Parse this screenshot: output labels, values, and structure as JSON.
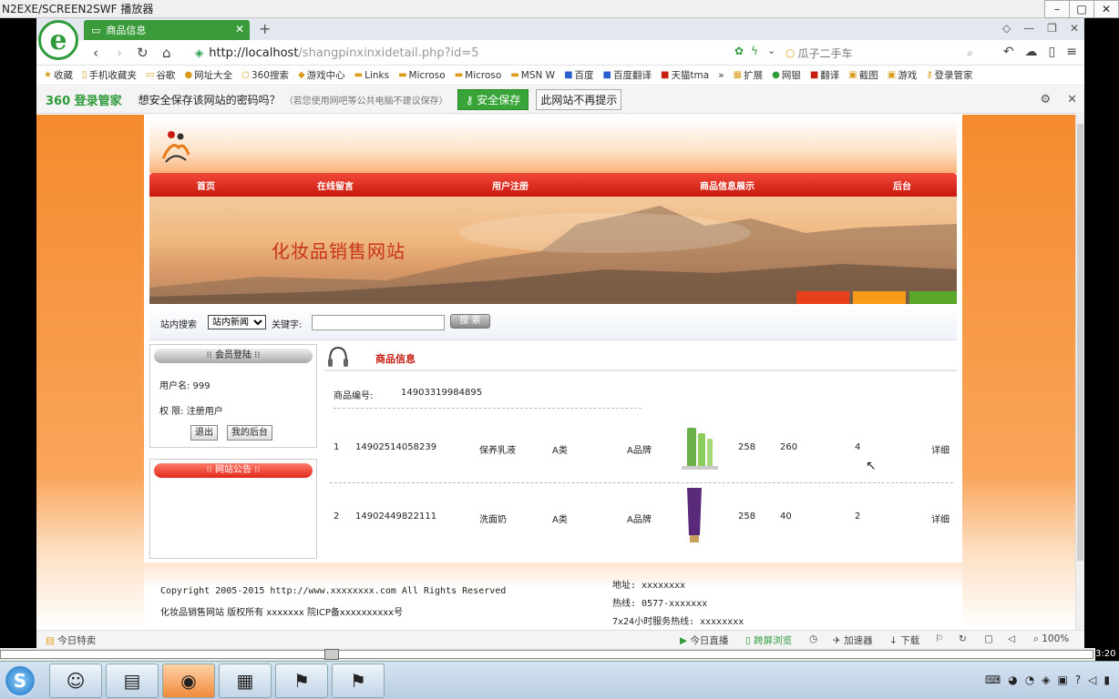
{
  "player": {
    "title": "N2EXE/SCREEN2SWF 播放器",
    "time": "3:20"
  },
  "browser": {
    "tab_title": "商品信息",
    "url_host": "http://localhost",
    "url_path": "/shangpinxinxidetail.php?id=5",
    "search_placeholder": "瓜子二手车",
    "bookmarks": [
      "收藏",
      "手机收藏夹",
      "谷歌",
      "网址大全",
      "360搜索",
      "游戏中心",
      "Links",
      "Microso",
      "Microso",
      "MSN W",
      "百度",
      "百度翻译",
      "天猫tma",
      "»",
      "扩展",
      "网银",
      "翻译",
      "截图",
      "游戏",
      "登录管家"
    ],
    "password_bar": {
      "logo": "360 登录管家",
      "text": "想安全保存该网站的密码吗？",
      "note": "（若您使用网吧等公共电脑不建议保存）",
      "save_label": "安全保存",
      "never_label": "此网站不再提示"
    },
    "status": {
      "left": "今日特卖",
      "items": [
        "今日直播",
        "跨屏浏览",
        "加速器",
        "下载"
      ],
      "zoom": "100%"
    }
  },
  "site": {
    "menu": [
      "首页",
      "在线留言",
      "用户注册",
      "商品信息展示",
      "后台"
    ],
    "banner_title": "化妆品销售网站",
    "search": {
      "label": "站内搜索",
      "select_value": "站内新闻",
      "keyword_label": "关键字:",
      "button": "搜 索"
    },
    "member": {
      "title": "会员登陆",
      "username_line": "用户名: 999",
      "role_line": "权  限: 注册用户",
      "logout": "退出",
      "my_admin": "我的后台"
    },
    "notice_title": "网站公告",
    "main": {
      "title": "商品信息",
      "code_label": "商品编号:",
      "code_value": "14903319984895",
      "rows": [
        {
          "idx": "1",
          "code": "14902514058239",
          "name": "保养乳液",
          "category": "A类",
          "brand": "A品牌",
          "price": "258",
          "qty": "260",
          "count": "4",
          "detail": "详细"
        },
        {
          "idx": "2",
          "code": "14902449822111",
          "name": "洗面奶",
          "category": "A类",
          "brand": "A品牌",
          "price": "258",
          "qty": "40",
          "count": "2",
          "detail": "详细"
        }
      ]
    },
    "footer": {
      "copyright": "Copyright 2005-2015 http://www.xxxxxxxx.com All Rights Reserved",
      "icp": "化妆品销售网站 版权所有 xxxxxxx 院ICP备xxxxxxxxxx号",
      "address": "地址: xxxxxxxx",
      "hotline": "热线: 0577-xxxxxxx",
      "service": "7x24小时服务热线: xxxxxxxx"
    }
  }
}
